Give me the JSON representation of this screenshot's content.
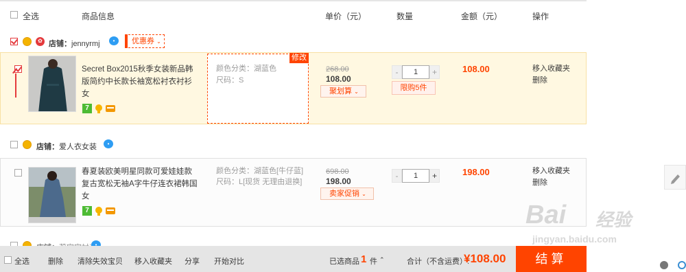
{
  "header": {
    "select_all": "全选",
    "product_info": "商品信息",
    "unit_price": "单价（元）",
    "quantity": "数量",
    "amount": "金额（元）",
    "operations": "操作"
  },
  "shops": [
    {
      "label": "店铺：",
      "name": "jennyrmj",
      "coupon": "优惠券",
      "item": {
        "title": "Secret Box2015秋季女装新品韩版简约中长款长袖宽松衬衣衬衫女",
        "sku_color": "颜色分类：湖蓝色",
        "sku_size": "尺码：S",
        "modify": "修改",
        "orig_price": "268.00",
        "price": "108.00",
        "promo": "聚划算",
        "qty": "1",
        "limit": "限购5件",
        "amount": "108.00",
        "op_fav": "移入收藏夹",
        "op_del": "删除",
        "checked": true
      }
    },
    {
      "label": "店铺：",
      "name": "爱人衣女装",
      "item": {
        "title": "春夏装欧美明星同款可爱娃娃款复古宽松无袖A字牛仔连衣裙韩国女",
        "sku_color": "颜色分类：湖蓝色[牛仔蓝]",
        "sku_size": "尺码：L[现货 无理由退换]",
        "orig_price": "698.00",
        "price": "198.00",
        "promo": "卖家促销",
        "qty": "1",
        "amount": "198.00",
        "op_fav": "移入收藏夹",
        "op_del": "删除",
        "checked": false
      }
    },
    {
      "label": "店铺：",
      "name": "莉家家衬装"
    }
  ],
  "footer": {
    "select_all": "全选",
    "delete": "删除",
    "clear_invalid": "清除失效宝贝",
    "move_fav": "移入收藏夹",
    "share": "分享",
    "compare": "开始对比",
    "selected_label": "已选商品",
    "selected_count": "1",
    "selected_unit": "件",
    "total_label": "合计（不含运费）:",
    "total_value": "¥108.00",
    "checkout": "结算"
  },
  "watermark": {
    "logo": "Bai",
    "logo2": "经验",
    "url": "jingyan.baidu.com"
  },
  "colors": {
    "accent": "#ff4400",
    "selected_row_bg": "#fff8e1",
    "footer_bg": "#e5e5e5"
  },
  "icons": [
    "shop-badge-gold-icon",
    "shop-badge-red-icon",
    "wangwang-chat-icon",
    "seven-day-return-icon",
    "quality-icon",
    "card-pay-icon",
    "pencil-icon",
    "chevron-down-icon"
  ]
}
